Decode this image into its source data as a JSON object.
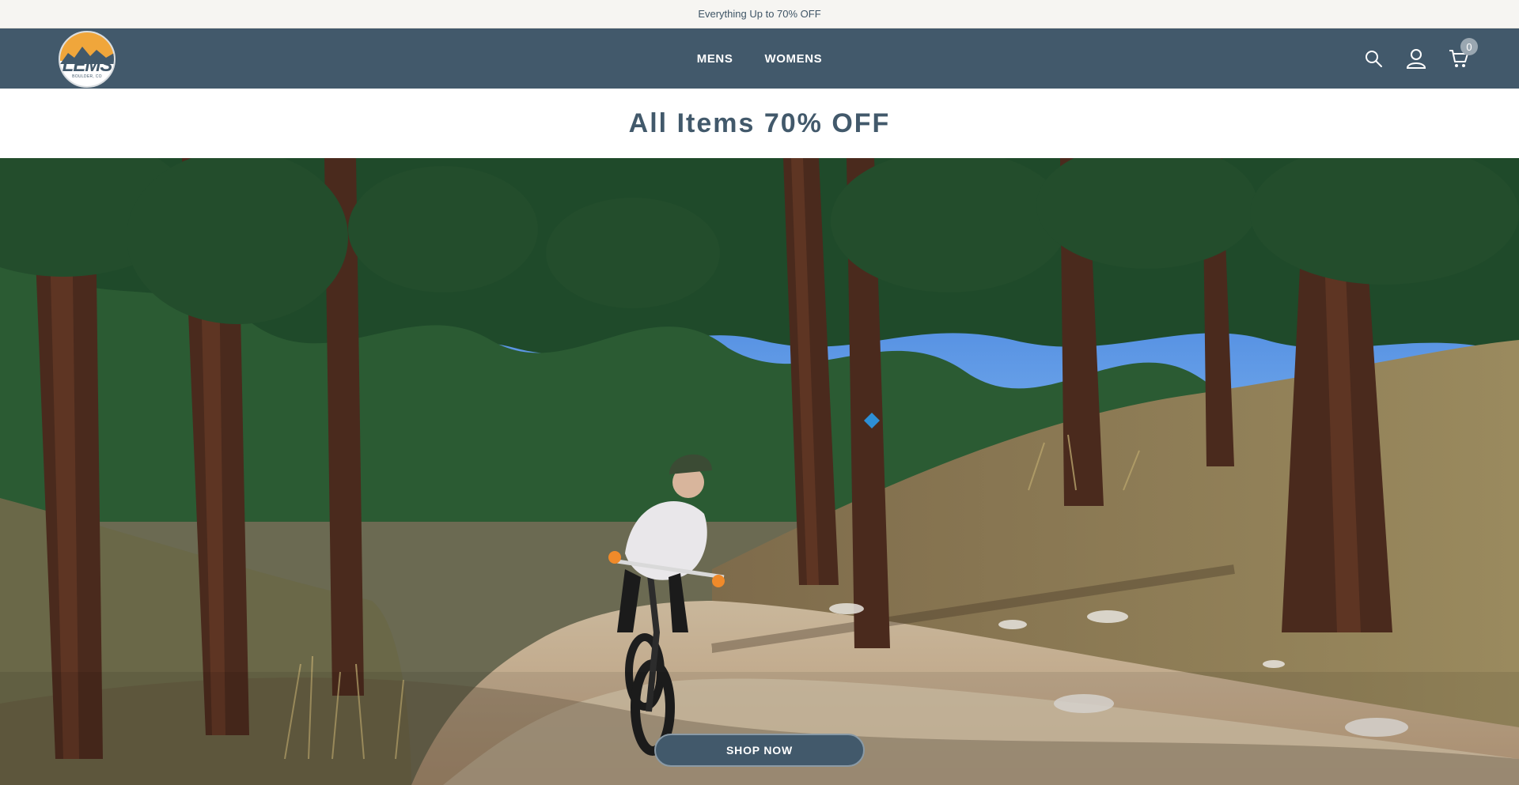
{
  "announcement": {
    "text": "Everything Up to 70% OFF"
  },
  "brand": {
    "logo_text": "LEMS",
    "logo_subtext": "BOULDER, CO"
  },
  "nav": {
    "items": [
      {
        "label": "MENS"
      },
      {
        "label": "WOMENS"
      }
    ]
  },
  "header_icons": {
    "search": "search-icon",
    "account": "account-icon",
    "cart": "cart-icon",
    "cart_count": "0"
  },
  "promo": {
    "headline": "All Items 70% OFF"
  },
  "hero": {
    "image_alt": "mountain-biker-forest-trail",
    "cta_label": "SHOP NOW"
  },
  "colors": {
    "brand_slate": "#42596b",
    "announcement_bg": "#f6f5f2",
    "logo_orange": "#f0a63b"
  }
}
